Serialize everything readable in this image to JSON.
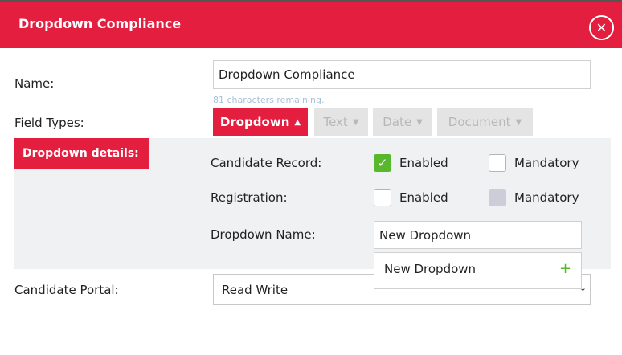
{
  "modal": {
    "title": "Dropdown Compliance",
    "close_icon": "close-icon",
    "accent_color": "#e41e3f"
  },
  "form": {
    "name_label": "Name:",
    "name_value": "Dropdown Compliance",
    "chars_remaining": "81 characters remaining.",
    "field_types_label": "Field Types:",
    "field_types": [
      {
        "label": "Dropdown",
        "state": "active"
      },
      {
        "label": "Text",
        "state": "disabled"
      },
      {
        "label": "Date",
        "state": "disabled"
      },
      {
        "label": "Document",
        "state": "disabled"
      }
    ],
    "portal_label": "Candidate Portal:",
    "portal_value": "Read Write"
  },
  "details": {
    "tag": "Dropdown details:",
    "candidate_record_label": "Candidate Record:",
    "registration_label": "Registration:",
    "enabled_label": "Enabled",
    "mandatory_label": "Mandatory",
    "candidate_record_enabled": true,
    "candidate_record_mandatory": false,
    "registration_enabled": false,
    "registration_mandatory_disabled": true,
    "dropdown_name_label": "Dropdown Name:",
    "dropdown_name_value": "New Dropdown",
    "suggestion": "New Dropdown"
  }
}
